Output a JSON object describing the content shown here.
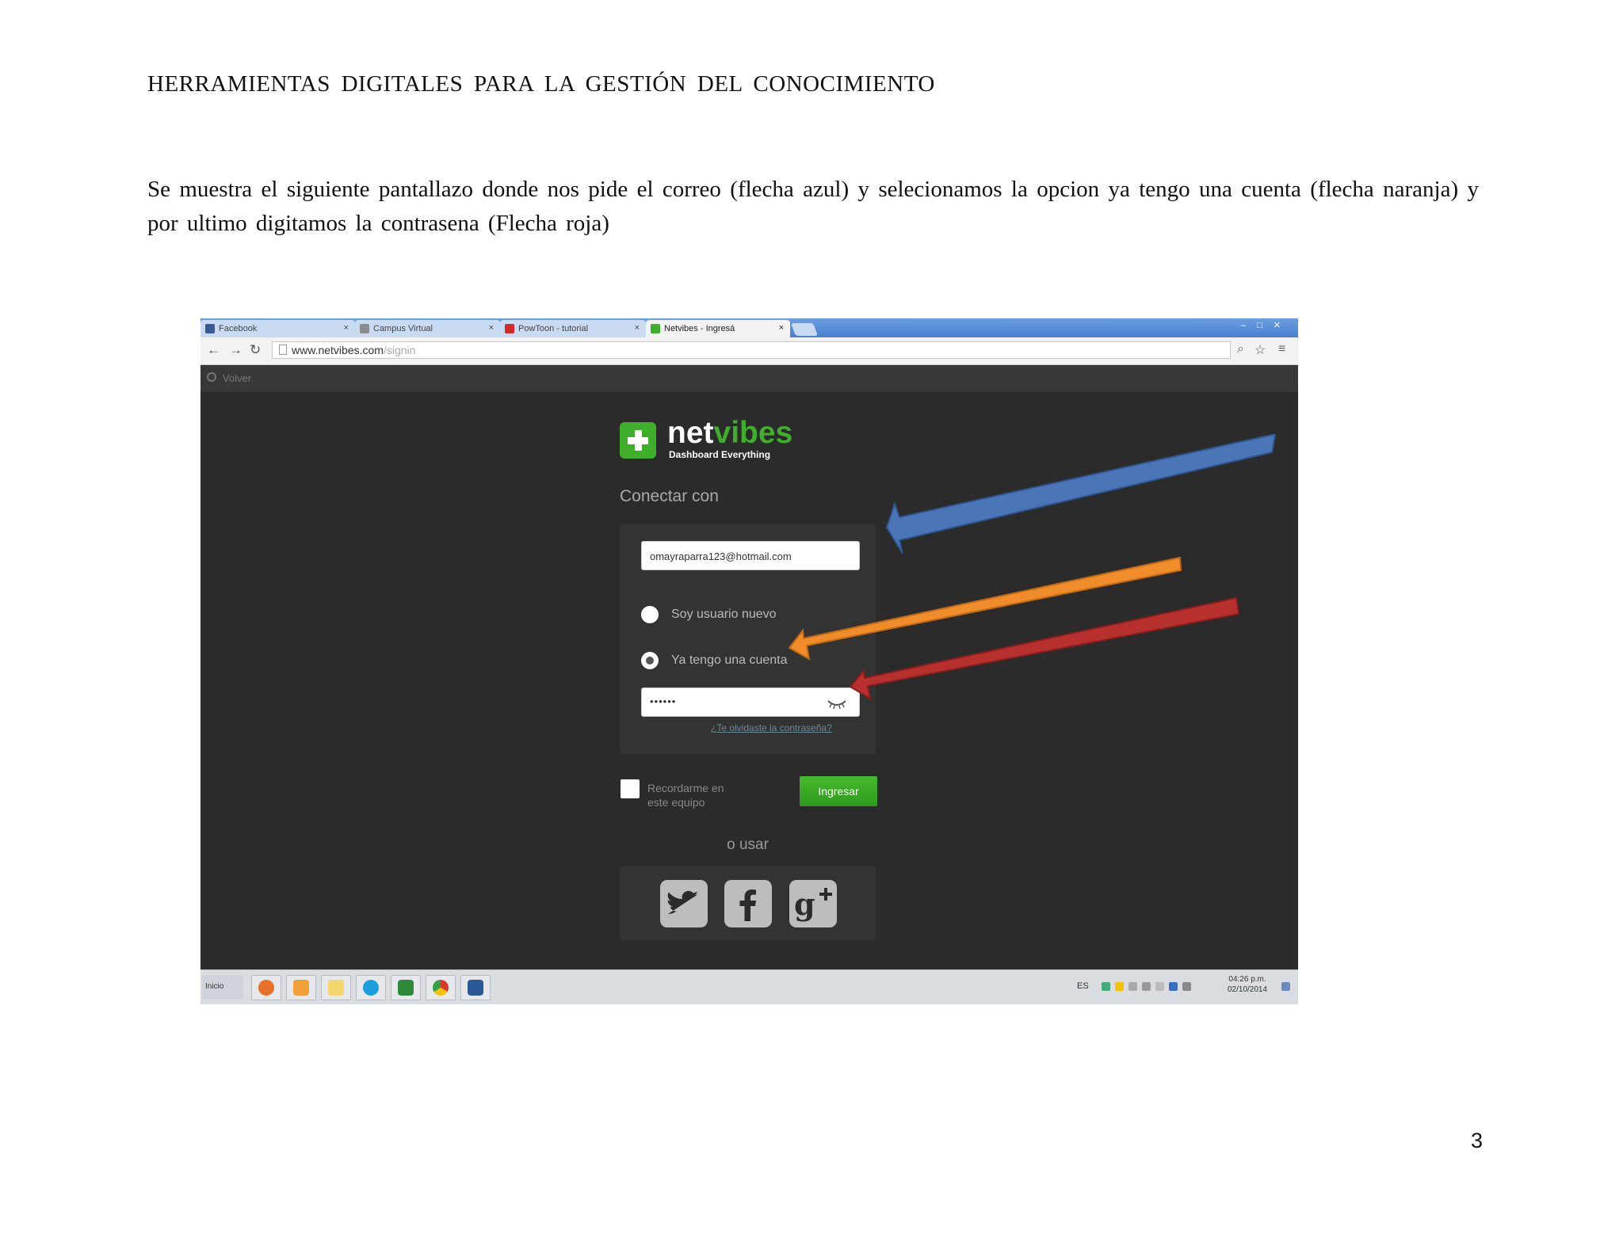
{
  "document": {
    "header": "HERRAMIENTAS  DIGITALES  PARA LA GESTIÓN DEL CONOCIMIENTO",
    "paragraph": "Se muestra el siguiente pantallazo donde nos pide el correo (flecha azul) y selecionamos la opcion ya tengo una cuenta (flecha naranja) y por ultimo digitamos la contrasena (Flecha roja)",
    "page_number": "3"
  },
  "browser": {
    "tabs": [
      {
        "label": "Facebook",
        "favicon_color": "#3b5998"
      },
      {
        "label": "Campus Virtual",
        "favicon_color": "#8c8c8c"
      },
      {
        "label": "PowToon - tutorial",
        "favicon_color": "#d22b2b"
      },
      {
        "label": "Netvibes - Ingresá",
        "favicon_color": "#3fae2a"
      }
    ],
    "tab_close_glyph": "×",
    "url_host": "www.netvibes.com",
    "url_path": "/signin"
  },
  "page": {
    "back_label": "Volver",
    "logo_word_1": "net",
    "logo_word_2": "vibes",
    "logo_tagline": "Dashboard Everything",
    "connect_label": "Conectar con",
    "email_value": "omayraparra123@hotmail.com",
    "radio_new_label": "Soy usuario nuevo",
    "radio_existing_label": "Ya tengo una cuenta",
    "password_value": "••••••",
    "forgot_link": "¿Te olvidaste la contraseña?",
    "remember_label": "Recordarme en este equipo",
    "login_button": "Ingresar",
    "or_use_label": "o usar"
  },
  "taskbar": {
    "start_label": "Inicio",
    "language": "ES",
    "time": "04:26 p.m.",
    "date": "02/10/2014"
  },
  "colors": {
    "brand_green": "#3fae2a",
    "arrow_blue": "#4a76b8",
    "arrow_orange": "#f08c2a",
    "arrow_red": "#b8302e"
  }
}
